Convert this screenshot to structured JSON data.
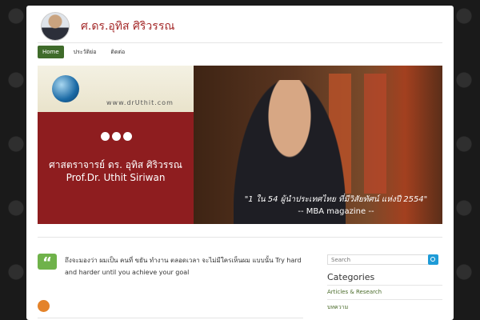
{
  "site": {
    "title": "ศ.ดร.อุทิส ศิริวรรณ"
  },
  "nav": {
    "items": [
      {
        "label": "Home",
        "active": true
      },
      {
        "label": "ประวัติย่อ",
        "active": false
      },
      {
        "label": "ติดต่อ",
        "active": false
      }
    ]
  },
  "hero": {
    "url_text": "www.drUthit.com",
    "name_thai": "ศาสตราจารย์ ดร. อุทิส ศิริวรรณ",
    "name_english": "Prof.Dr. Uthit Siriwan",
    "quote": "\"1 ใน 54 ผู้นำประเทศไทย ที่มีวิสัยทัศน์ แห่งปี 2554\"",
    "quote_source": "-- MBA magazine --"
  },
  "post": {
    "text": "ถึงจะมองว่า ผมเป็น คนที่ ขยัน ทำงาน ตลอดเวลา จะไม่มีใครเห็นผม แบบนั้น Try hard and harder until you achieve your goal"
  },
  "sidebar": {
    "search_placeholder": "Search",
    "categories_title": "Categories",
    "categories": [
      "Articles & Research",
      "บทความ"
    ]
  },
  "colors": {
    "nav_active": "#3f6b2a",
    "hero_red": "#8e1d1f",
    "quote_icon": "#6fb24a",
    "search_btn": "#1e9bd7"
  }
}
